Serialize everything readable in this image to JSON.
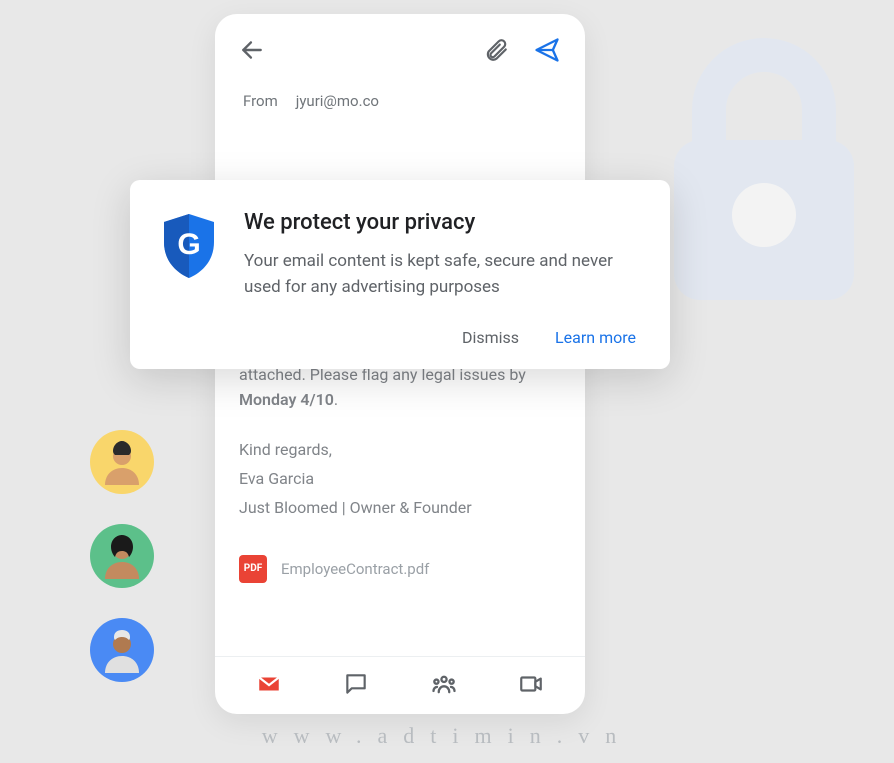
{
  "compose": {
    "from_label": "From",
    "from_email": "jyuri@mo.co",
    "body_line1": "See Just Bloomed employee contract attached. Please flag any legal issues by ",
    "deadline": "Monday 4/10",
    "body_deadline_suffix": ".",
    "signoff": "Kind regards,",
    "sender_name": "Eva Garcia",
    "sender_title": "Just Bloomed | Owner & Founder",
    "attachment_badge": "PDF",
    "attachment_name": "EmployeeContract.pdf"
  },
  "dialog": {
    "shield_letter": "G",
    "title": "We protect your privacy",
    "body": "Your email content is kept safe, secure and never used for any advertising purposes",
    "dismiss": "Dismiss",
    "learn_more": "Learn more"
  },
  "watermark": "www.adtimin.vn",
  "colors": {
    "accent_blue": "#1a73e8",
    "mail_red": "#ea4335",
    "icon_gray": "#5f6368",
    "bg_lock": "#d9e3f8"
  }
}
